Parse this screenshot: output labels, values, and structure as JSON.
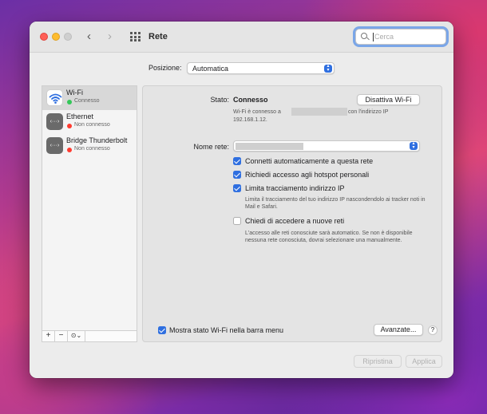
{
  "window": {
    "title": "Rete",
    "search_placeholder": "Cerca"
  },
  "location": {
    "label": "Posizione:",
    "value": "Automatica"
  },
  "services": [
    {
      "name": "Wi-Fi",
      "status": "Connesso",
      "status_color": "#34c759",
      "icon": "wifi-icon",
      "selected": true
    },
    {
      "name": "Ethernet",
      "status": "Non connesso",
      "status_color": "#ff3b30",
      "icon": "ethernet-icon",
      "selected": false
    },
    {
      "name": "Bridge Thunderbolt",
      "status": "Non connesso",
      "status_color": "#ff3b30",
      "icon": "thunderbolt-bridge-icon",
      "selected": false
    }
  ],
  "sidebar_toolbar": {
    "add": "+",
    "remove": "−",
    "actions": "⊙⌄"
  },
  "wifi": {
    "status_label": "Stato:",
    "status_value": "Connesso",
    "toggle_button": "Disattiva Wi-Fi",
    "info_prefix": "Wi-Fi è connesso a",
    "info_suffix": "con l'indirizzo IP",
    "ip": "192.168.1.12.",
    "network_label": "Nome rete:",
    "options": [
      {
        "label": "Connetti automaticamente a questa rete",
        "checked": true,
        "desc": ""
      },
      {
        "label": "Richiedi accesso agli hotspot personali",
        "checked": true,
        "desc": ""
      },
      {
        "label": "Limita tracciamento indirizzo IP",
        "checked": true,
        "desc": "Limita il tracciamento del tuo indirizzo IP nascondendolo ai tracker noti in Mail e Safari."
      },
      {
        "label": "Chiedi di accedere a nuove reti",
        "checked": false,
        "desc": "L'accesso alle reti conosciute sarà automatico. Se non è disponibile nessuna rete conosciuta, dovrai selezionare una manualmente."
      }
    ],
    "menu_bar_label": "Mostra stato Wi-Fi nella barra menu",
    "advanced_button": "Avanzate...",
    "help_button": "?"
  },
  "footer": {
    "revert": "Ripristina",
    "apply": "Applica"
  },
  "colors": {
    "accent": "#2f6fe0",
    "connected": "#34c759",
    "disconnected": "#ff3b30"
  }
}
